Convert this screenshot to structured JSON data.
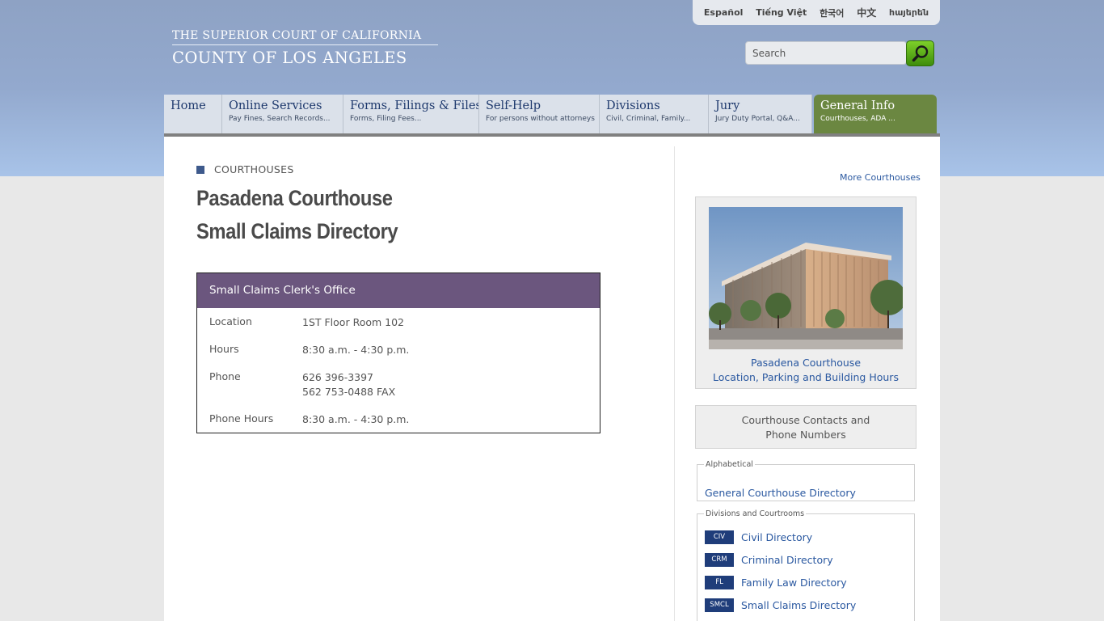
{
  "header": {
    "logo_line1": "THE SUPERIOR COURT OF CALIFORNIA",
    "logo_line2": "COUNTY OF LOS ANGELES",
    "languages": [
      "Español",
      "Tiếng Việt",
      "한국어",
      "中文",
      "հայերեն"
    ],
    "search_placeholder": "Search"
  },
  "nav": [
    {
      "title": "Home",
      "subtitle": ""
    },
    {
      "title": "Online Services",
      "subtitle": "Pay Fines, Search Records..."
    },
    {
      "title": "Forms, Filings & Files",
      "subtitle": "Forms, Filing Fees..."
    },
    {
      "title": "Self-Help",
      "subtitle": "For persons without attorneys"
    },
    {
      "title": "Divisions",
      "subtitle": "Civil, Criminal, Family..."
    },
    {
      "title": "Jury",
      "subtitle": "Jury Duty Portal, Q&A..."
    },
    {
      "title": "General Info",
      "subtitle": "Courthouses, ADA ..."
    }
  ],
  "main": {
    "breadcrumb": "COURTHOUSES",
    "title_line1": "Pasadena Courthouse",
    "title_line2": "Small Claims Directory",
    "office": {
      "heading": "Small Claims Clerk's Office",
      "rows": [
        {
          "label": "Location",
          "value": "1ST Floor Room 102"
        },
        {
          "label": "Hours",
          "value": "8:30 a.m. - 4:30 p.m."
        },
        {
          "label": "Phone",
          "value": "626 396-3397",
          "value2": "562 753-0488 FAX"
        },
        {
          "label": "Phone Hours",
          "value": "8:30 a.m. - 4:30 p.m."
        }
      ]
    }
  },
  "sidebar": {
    "more_link": "More Courthouses",
    "photo_caption_line1": "Pasadena Courthouse",
    "photo_caption_line2": "Location, Parking and Building Hours",
    "contacts_line1": "Courthouse Contacts and",
    "contacts_line2": "Phone Numbers",
    "alpha_legend": "Alphabetical",
    "alpha_link": "General Courthouse Directory",
    "div_legend": "Divisions and Courtrooms",
    "directories": [
      {
        "badge": "CIV",
        "label": "Civil Directory"
      },
      {
        "badge": "CRM",
        "label": "Criminal Directory"
      },
      {
        "badge": "FL",
        "label": "Family Law Directory"
      },
      {
        "badge": "SMCL",
        "label": "Small Claims Directory"
      }
    ]
  },
  "colors": {
    "nav_active": "#6b8741",
    "box_header": "#6b567e",
    "link": "#2a58a0",
    "badge": "#1f3d7a"
  }
}
